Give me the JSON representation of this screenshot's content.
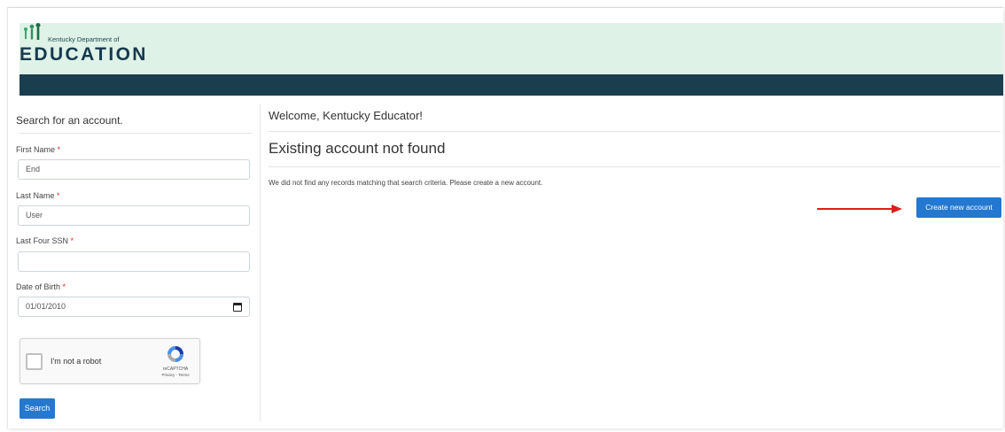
{
  "header": {
    "org_small": "Kentucky Department of",
    "org_big": "EDUCATION",
    "brand_bg": "#dff2e8",
    "nav_bg": "#1b3e4f"
  },
  "search_panel": {
    "title": "Search for an account.",
    "fields": [
      {
        "label": "First Name",
        "required_mark": "*",
        "value": "End"
      },
      {
        "label": "Last Name",
        "required_mark": "*",
        "value": "User"
      },
      {
        "label": "Last Four SSN",
        "required_mark": "*",
        "value": ""
      },
      {
        "label": "Date of Birth",
        "required_mark": "*",
        "value": "01/01/2010"
      }
    ],
    "recaptcha": {
      "label": "I'm not a robot",
      "brand": "reCAPTCHA",
      "terms": "Privacy - Terms"
    },
    "search_button": "Search"
  },
  "main": {
    "welcome": "Welcome, Kentucky Educator!",
    "heading": "Existing account not found",
    "message": "We did not find any records matching that search criteria. Please create a new account.",
    "create_button": "Create new account",
    "accent_color": "#2478d0",
    "annotation_arrow_color": "#e11b1b"
  }
}
